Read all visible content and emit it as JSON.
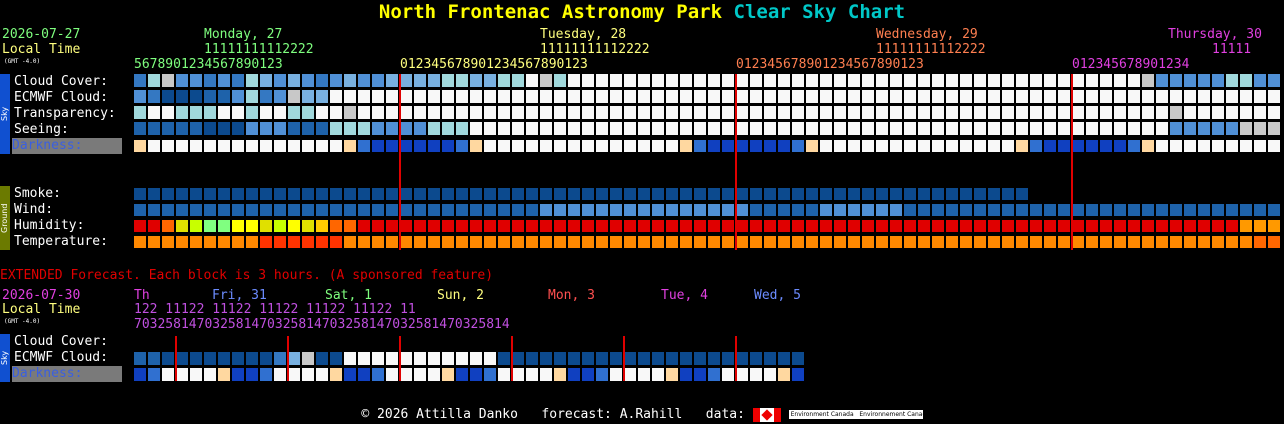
{
  "title": {
    "site": "North Frontenac Astronomy Park",
    "chart": "Clear Sky Chart",
    "site_color": "#ffff00",
    "chart_color": "#00c8c8"
  },
  "top": {
    "date": "2026-07-27",
    "local_time": "Local Time",
    "gmt": "(GMT -4.0)",
    "days": [
      {
        "label": "Monday, 27",
        "color": "#7fff7f"
      },
      {
        "label": "Tuesday, 28",
        "color": "#ffff7f"
      },
      {
        "label": "Wednesday, 29",
        "color": "#ff7f50"
      },
      {
        "label": "Thursday, 30",
        "color": "#e040e0"
      }
    ],
    "tens_rows": [
      {
        "text": "11111111112222",
        "color": "#7fff7f"
      },
      {
        "text": "11111111112222",
        "color": "#ffff7f"
      },
      {
        "text": "11111111112222",
        "color": "#ff7f50"
      },
      {
        "text": "11111",
        "color": "#e040e0"
      }
    ],
    "hours_segments": [
      {
        "text": "5678901234567890123",
        "color": "#7fff7f"
      },
      {
        "text": "012345678901234567890123",
        "color": "#ffff7f"
      },
      {
        "text": "012345678901234567890123",
        "color": "#ff7f50"
      },
      {
        "text": "012345678901234",
        "color": "#e040e0"
      }
    ],
    "sky_side": "Sky",
    "ground_side": "Ground",
    "sky_rows": [
      "Cloud Cover:",
      "ECMWF Cloud:",
      "Transparency:",
      "Seeing:",
      "Darkness:"
    ],
    "ground_rows": [
      "Smoke:",
      "Wind:",
      "Humidity:",
      "Temperature:"
    ]
  },
  "extended": {
    "note": "EXTENDED Forecast. Each block is 3 hours. (A sponsored feature)",
    "date": "2026-07-30",
    "local_time": "Local Time",
    "gmt": "(GMT -4.0)",
    "days": [
      {
        "label": "Th",
        "color": "#e040e0"
      },
      {
        "label": "Fri, 31",
        "color": "#6c8cff"
      },
      {
        "label": "Sat, 1",
        "color": "#7fff7f"
      },
      {
        "label": "Sun, 2",
        "color": "#ffff7f"
      },
      {
        "label": "Mon, 3",
        "color": "#ff5050"
      },
      {
        "label": "Tue, 4",
        "color": "#e040e0"
      },
      {
        "label": "Wed, 5",
        "color": "#6c8cff"
      }
    ],
    "tens": "122  11122  11122  11122  11122  11122  11",
    "hours": "703258147032581470325814703258147032581470325814",
    "sky_side": "Sky",
    "rows": [
      "Cloud Cover:",
      "ECMWF Cloud:",
      "Darkness:"
    ]
  },
  "footer": {
    "copyright": "© 2026 Attilla Danko",
    "forecast": "forecast: A.Rahill",
    "data": "data:",
    "env1": "Environment Canada",
    "env2": "Environnement Canada"
  },
  "colors": {
    "cloud": [
      "#003c7c",
      "#0c4a8e",
      "#1e62aa",
      "#3478c2",
      "#5090d6",
      "#78b0e0",
      "#a0d8dc",
      "#c8c8c8",
      "#f8f8f8"
    ],
    "dark_red": "#e00000"
  }
}
